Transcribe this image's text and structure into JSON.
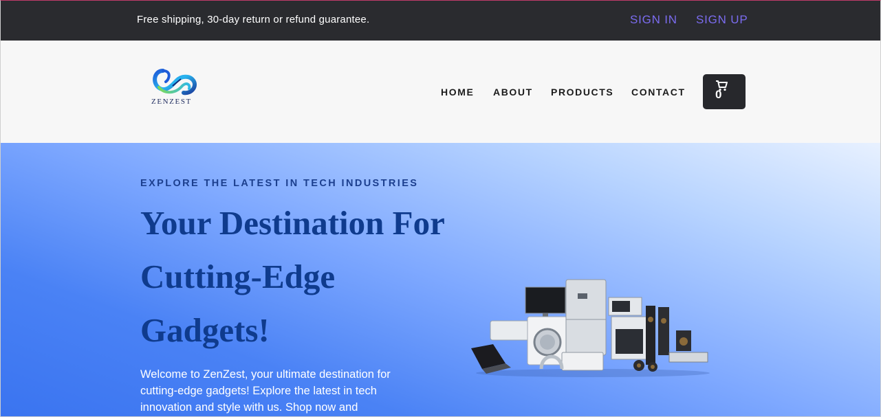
{
  "topbar": {
    "notice": "Free shipping, 30-day return or refund guarantee.",
    "sign_in": "SIGN IN",
    "sign_up": "SIGN UP"
  },
  "header": {
    "logo_text": "ZENZEST",
    "nav": {
      "home": "HOME",
      "about": "ABOUT",
      "products": "PRODUCTS",
      "contact": "CONTACT"
    },
    "cart": {
      "icon": "cart-icon",
      "count": "0"
    }
  },
  "hero": {
    "eyebrow": "EXPLORE THE LATEST IN TECH INDUSTRIES",
    "headline": "Your Destination For Cutting-Edge Gadgets!",
    "intro": "Welcome to ZenZest, your ultimate destination for cutting-edge gadgets! Explore the latest in tech innovation and style with us. Shop now and",
    "image": "home-appliances-and-electronics-image"
  },
  "colors": {
    "topbar_bg": "#2a2b2f",
    "auth_link": "#7b6cf0",
    "header_bg": "#f7f7f7",
    "headline": "#0f3b8d",
    "eyebrow": "#1c3f8e",
    "cart_bg": "#27282c"
  }
}
